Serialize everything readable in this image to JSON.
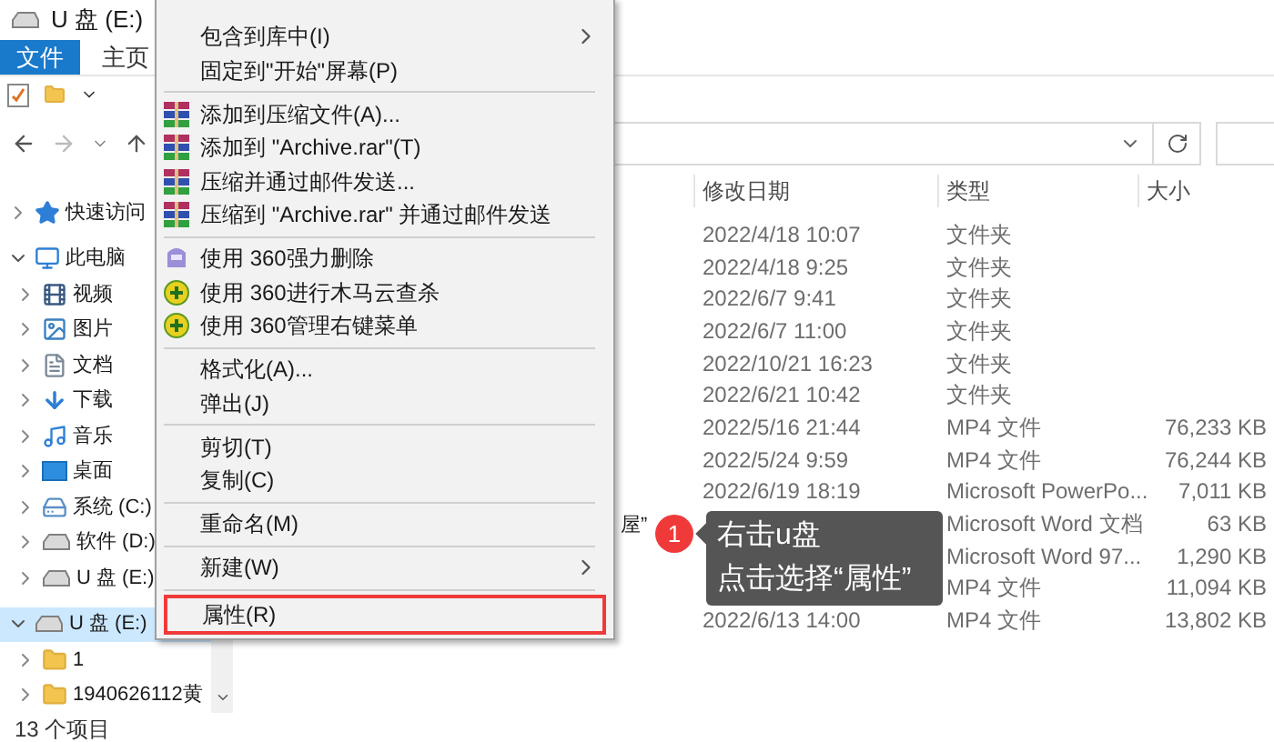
{
  "window": {
    "title": "U 盘 (E:)"
  },
  "ribbon_tabs": [
    {
      "label": "文件",
      "selected": true
    },
    {
      "label": "主页",
      "selected": false
    }
  ],
  "sidebar": {
    "items": [
      {
        "label": "快速访问",
        "kind": "star",
        "expanded": false,
        "selected": false
      },
      {
        "label": "此电脑",
        "kind": "computer",
        "expanded": true,
        "selected": false,
        "children": [
          {
            "label": "视频",
            "kind": "video",
            "expanded": false,
            "selected": false
          },
          {
            "label": "图片",
            "kind": "picture",
            "expanded": false,
            "selected": false
          },
          {
            "label": "文档",
            "kind": "document",
            "expanded": false,
            "selected": false
          },
          {
            "label": "下载",
            "kind": "download",
            "expanded": false,
            "selected": false
          },
          {
            "label": "音乐",
            "kind": "music",
            "expanded": false,
            "selected": false
          },
          {
            "label": "桌面",
            "kind": "desktop",
            "expanded": false,
            "selected": false
          },
          {
            "label": "系统 (C:)",
            "kind": "system-drive",
            "expanded": false,
            "selected": false
          },
          {
            "label": "软件 (D:)",
            "kind": "drive",
            "expanded": false,
            "selected": false
          },
          {
            "label": "U 盘 (E:)",
            "kind": "drive",
            "expanded": false,
            "selected": false
          }
        ]
      },
      {
        "label": "U 盘 (E:)",
        "kind": "drive",
        "expanded": true,
        "selected": true,
        "children": [
          {
            "label": "1",
            "kind": "folder",
            "expanded": false,
            "selected": false
          },
          {
            "label": "1940626112黄",
            "kind": "folder",
            "expanded": false,
            "selected": false
          }
        ]
      }
    ]
  },
  "table": {
    "columns": [
      "修改日期",
      "类型",
      "大小"
    ],
    "rows": [
      {
        "date": "2022/4/18 10:07",
        "type": "文件夹"
      },
      {
        "date": "2022/4/18 9:25",
        "type": "文件夹"
      },
      {
        "date": "2022/6/7 9:41",
        "type": "文件夹"
      },
      {
        "date": "2022/6/7 11:00",
        "type": "文件夹"
      },
      {
        "date": "2022/10/21 16:23",
        "type": "文件夹"
      },
      {
        "date": "2022/6/21 10:42",
        "type": "文件夹"
      },
      {
        "date": "2022/5/16 21:44",
        "type": "MP4 文件",
        "size": "76,233 KB"
      },
      {
        "date": "2022/5/24 9:59",
        "type": "MP4 文件",
        "size": "76,244 KB"
      },
      {
        "date": "2022/6/19 18:19",
        "type": "Microsoft PowerPo...",
        "size": "7,011 KB"
      },
      {
        "name": "屋”",
        "type": "Microsoft Word 文档",
        "size": "63 KB"
      },
      {
        "type": "Microsoft Word 97...",
        "size": "1,290 KB"
      },
      {
        "type": "MP4 文件",
        "size": "11,094 KB"
      },
      {
        "date": "2022/6/13 14:00",
        "type": "MP4 文件",
        "size": "13,802 KB"
      }
    ]
  },
  "status_bar": "13 个项目",
  "context_menu": {
    "groups": [
      [
        {
          "label": "包含到库中(I)",
          "submenu": true,
          "selected": false
        },
        {
          "label": "固定到\"开始\"屏幕(P)",
          "submenu": false,
          "selected": false
        }
      ],
      [
        {
          "label": "添加到压缩文件(A)...",
          "kind": "archive",
          "submenu": false,
          "selected": false
        },
        {
          "label": "添加到 \"Archive.rar\"(T)",
          "kind": "archive",
          "submenu": false,
          "selected": false
        },
        {
          "label": "压缩并通过邮件发送...",
          "kind": "archive",
          "submenu": false,
          "selected": false
        },
        {
          "label": "压缩到 \"Archive.rar\" 并通过邮件发送",
          "kind": "archive",
          "submenu": false,
          "selected": false
        }
      ],
      [
        {
          "label": "使用 360强力删除",
          "kind": "shredder",
          "submenu": false,
          "selected": false
        },
        {
          "label": "使用 360进行木马云查杀",
          "kind": "plus-circle",
          "submenu": false,
          "selected": false
        },
        {
          "label": "使用 360管理右键菜单",
          "kind": "plus-circle",
          "submenu": false,
          "selected": false
        }
      ],
      [
        {
          "label": "格式化(A)...",
          "kind": "plain",
          "submenu": false,
          "selected": false
        },
        {
          "label": "弹出(J)",
          "kind": "plain",
          "submenu": false,
          "selected": false
        }
      ],
      [
        {
          "label": "剪切(T)",
          "kind": "plain",
          "submenu": false,
          "selected": false
        },
        {
          "label": "复制(C)",
          "kind": "plain",
          "submenu": false,
          "selected": false
        }
      ],
      [
        {
          "label": "重命名(M)",
          "kind": "plain",
          "submenu": false,
          "selected": false
        }
      ],
      [
        {
          "label": "新建(W)",
          "kind": "plain",
          "submenu": true,
          "selected": false
        }
      ],
      [
        {
          "label": "属性(R)",
          "kind": "plain",
          "submenu": false,
          "selected": true
        }
      ]
    ]
  },
  "callout": {
    "badge": "1",
    "lines": [
      "右击u盘",
      "点击选择“属性”"
    ]
  }
}
